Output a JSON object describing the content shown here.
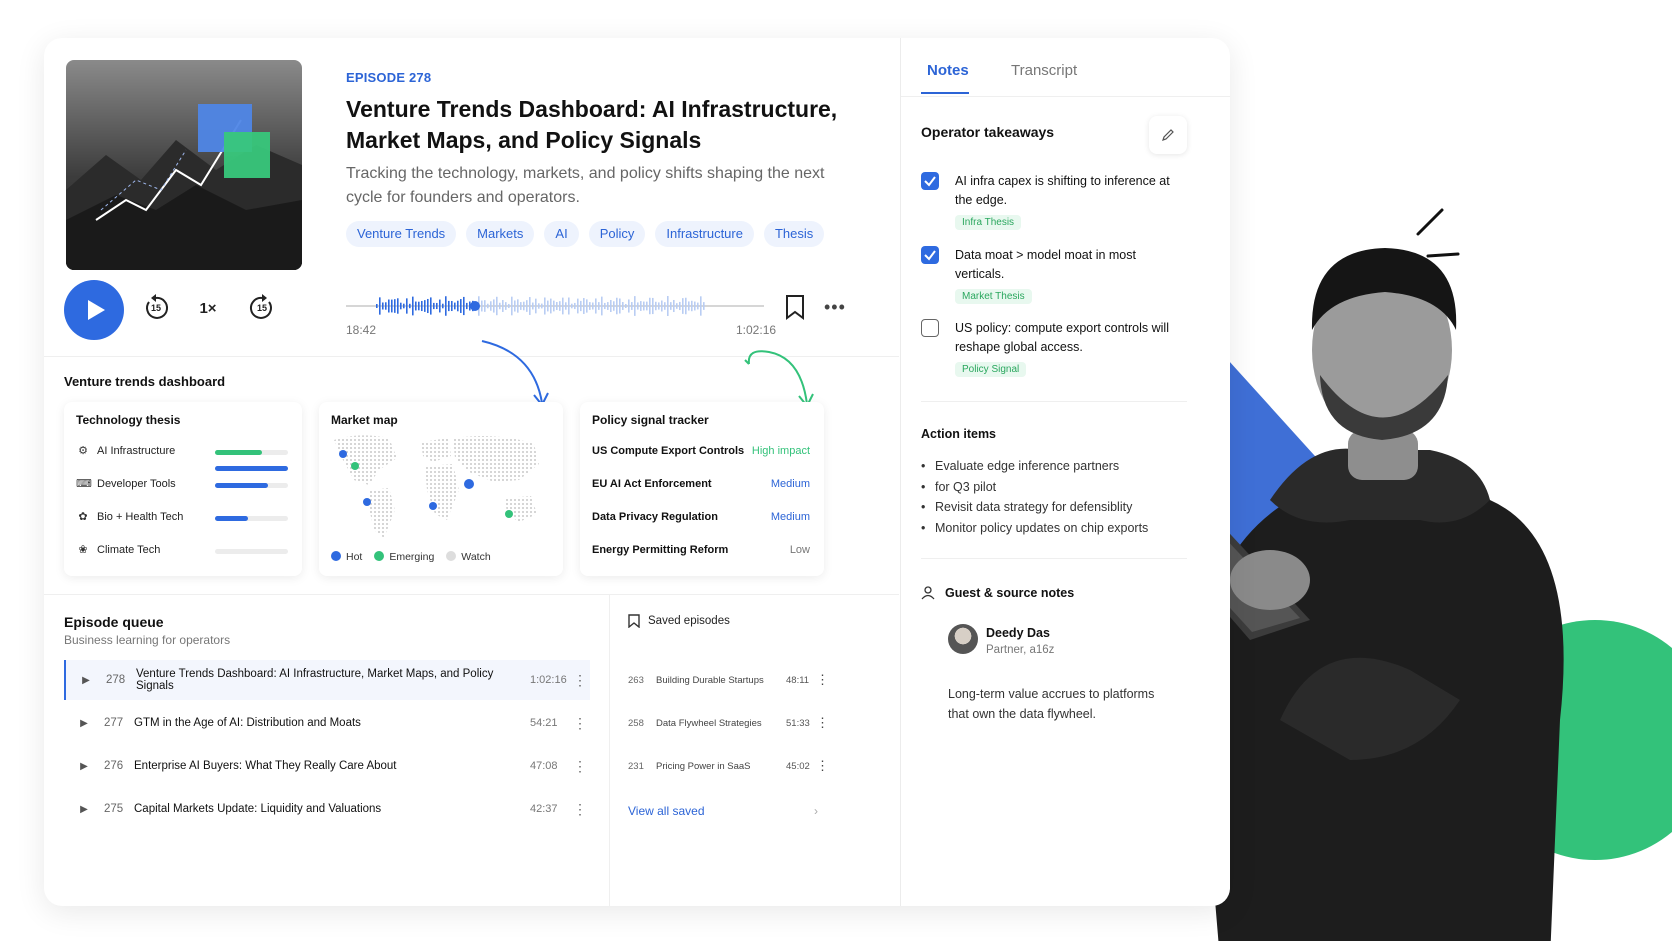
{
  "episode": {
    "eyebrow": "EPISODE 278",
    "title": "Venture Trends Dashboard: AI Infrastructure, Market Maps, and Policy Signals",
    "subtitle": "Tracking the technology, markets, and policy shifts shaping the next cycle for founders and operators.",
    "tags": [
      "Venture Trends",
      "Markets",
      "AI",
      "Policy",
      "Infrastructure",
      "Thesis"
    ]
  },
  "player": {
    "skip_back": "15",
    "speed": "1×",
    "skip_forward": "15",
    "elapsed": "18:42",
    "total": "1:02:16",
    "progress_fraction": 0.3
  },
  "dashboard": {
    "title": "Venture trends dashboard",
    "technology": {
      "title": "Technology thesis",
      "rows": [
        {
          "label": "AI Infrastructure",
          "value": 0.65,
          "color": "#33c27a"
        },
        {
          "label": "Developer Tools",
          "value": 0.72,
          "color": "#2e6ae0"
        },
        {
          "label": "Bio + Health Tech",
          "value": 0.45,
          "color": "#2e6ae0"
        },
        {
          "label": "Climate Tech",
          "value": 0.0,
          "color": "#cccccc"
        }
      ]
    },
    "market_map": {
      "title": "Market map",
      "legend": [
        {
          "label": "Hot",
          "color": "#2e6ae0"
        },
        {
          "label": "Emerging",
          "color": "#33c27a"
        },
        {
          "label": "Watch",
          "color": "#dddddd"
        }
      ]
    },
    "policy": {
      "title": "Policy signal tracker",
      "rows": [
        {
          "name": "US Compute Export Controls",
          "level": "High impact",
          "color": "#33c27a"
        },
        {
          "name": "EU AI Act Enforcement",
          "level": "Medium",
          "color": "#2c64d6"
        },
        {
          "name": "Data Privacy Regulation",
          "level": "Medium",
          "color": "#2c64d6"
        },
        {
          "name": "Energy Permitting Reform",
          "level": "Low",
          "color": "#777777"
        }
      ]
    }
  },
  "queue": {
    "title": "Episode queue",
    "subtitle": "Business learning for operators",
    "items": [
      {
        "num": "278",
        "title": "Venture Trends Dashboard: AI Infrastructure, Market Maps, and Policy Signals",
        "duration": "1:02:16"
      },
      {
        "num": "277",
        "title": "GTM in the Age of AI: Distribution and Moats",
        "duration": "54:21"
      },
      {
        "num": "276",
        "title": "Enterprise AI Buyers: What They Really Care About",
        "duration": "47:08"
      },
      {
        "num": "275",
        "title": "Capital Markets Update: Liquidity and Valuations",
        "duration": "42:37"
      }
    ]
  },
  "saved": {
    "title": "Saved episodes",
    "items": [
      {
        "num": "263",
        "title": "Building Durable Startups",
        "duration": "48:11"
      },
      {
        "num": "258",
        "title": "Data Flywheel Strategies",
        "duration": "51:33"
      },
      {
        "num": "231",
        "title": "Pricing Power in SaaS",
        "duration": "45:02"
      }
    ],
    "view_all": "View all saved",
    "chevron": "›"
  },
  "notes": {
    "tabs": [
      "Notes",
      "Transcript"
    ],
    "takeaways_title": "Operator takeaways",
    "takeaways": [
      {
        "text": "AI infra capex is shifting to inference at the edge.",
        "tag": "Infra Thesis",
        "checked": true
      },
      {
        "text": "Data moat > model moat in most verticals.",
        "tag": "Market Thesis",
        "checked": true
      },
      {
        "text": "US policy: compute export controls will reshape global access.",
        "tag": "Policy Signal",
        "checked": false
      }
    ],
    "actions_title": "Action items",
    "actions": [
      "Evaluate edge inference partners",
      "for Q3 pilot",
      "Revisit data strategy for defensiblity",
      "Monitor policy updates on chip exports"
    ],
    "guest_title": "Guest & source notes",
    "guest_name": "Deedy Das",
    "guest_role": "Partner, a16z",
    "guest_quote": "Long-term value accrues to platforms that own the data flywheel."
  }
}
